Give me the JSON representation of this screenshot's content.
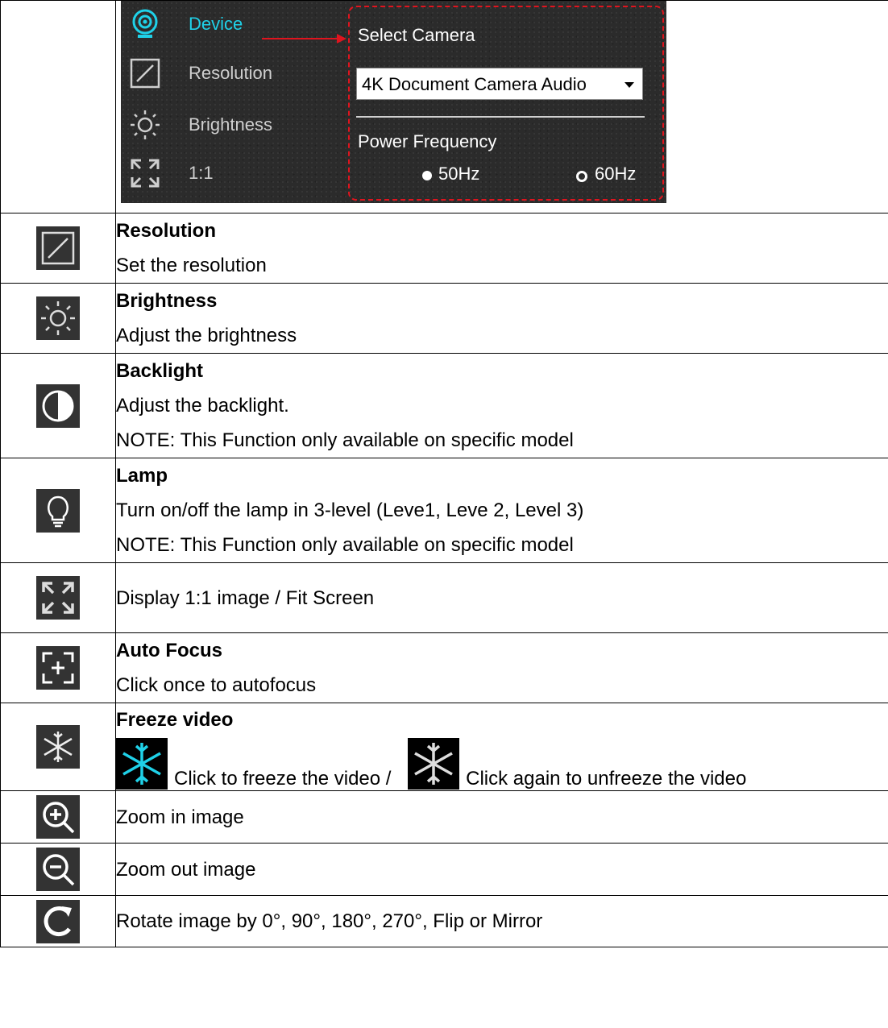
{
  "screenshot": {
    "menu": [
      {
        "label": "Device",
        "icon": "webcam-icon",
        "active": true
      },
      {
        "label": "Resolution",
        "icon": "resolution-icon",
        "active": false
      },
      {
        "label": "Brightness",
        "icon": "brightness-icon",
        "active": false
      },
      {
        "label": "1:1",
        "icon": "fit-screen-icon",
        "active": false
      }
    ],
    "select_camera_label": "Select Camera",
    "camera_value": "4K Document Camera Audio",
    "power_frequency_label": "Power Frequency",
    "freq_options": [
      {
        "label": "50Hz",
        "selected": true
      },
      {
        "label": "60Hz",
        "selected": false
      }
    ],
    "accent_color": "#1fd1e8",
    "callout_color": "#e0141e"
  },
  "rows": [
    {
      "icon": "resolution-icon",
      "title": "Resolution",
      "lines": [
        "Set the resolution"
      ]
    },
    {
      "icon": "brightness-icon",
      "title": "Brightness",
      "lines": [
        "Adjust the brightness"
      ]
    },
    {
      "icon": "backlight-icon",
      "title": "Backlight",
      "lines": [
        "Adjust the backlight.",
        "NOTE: This Function only available on specific model"
      ]
    },
    {
      "icon": "lamp-icon",
      "title": "Lamp",
      "lines": [
        "Turn on/off the lamp in 3-level (Leve1, Leve 2, Level 3)",
        "NOTE: This Function only available on specific model"
      ]
    },
    {
      "icon": "fit-screen-icon",
      "title": "",
      "lines": [
        "Display 1:1 image / Fit Screen"
      ]
    },
    {
      "icon": "auto-focus-icon",
      "title": "Auto Focus",
      "lines": [
        "Click once to autofocus"
      ]
    },
    {
      "icon": "freeze-icon",
      "title": "Freeze video",
      "freeze_text_1": "Click to freeze the video /",
      "freeze_text_2": "Click again to unfreeze the video",
      "freeze_active_color": "#1fd1e8"
    },
    {
      "icon": "zoom-in-icon",
      "title": "",
      "lines": [
        "Zoom in image"
      ]
    },
    {
      "icon": "zoom-out-icon",
      "title": "",
      "lines": [
        "Zoom out image"
      ]
    },
    {
      "icon": "rotate-icon",
      "title": "",
      "lines": [
        "Rotate image by 0°, 90°, 180°, 270°, Flip or Mirror"
      ]
    }
  ]
}
